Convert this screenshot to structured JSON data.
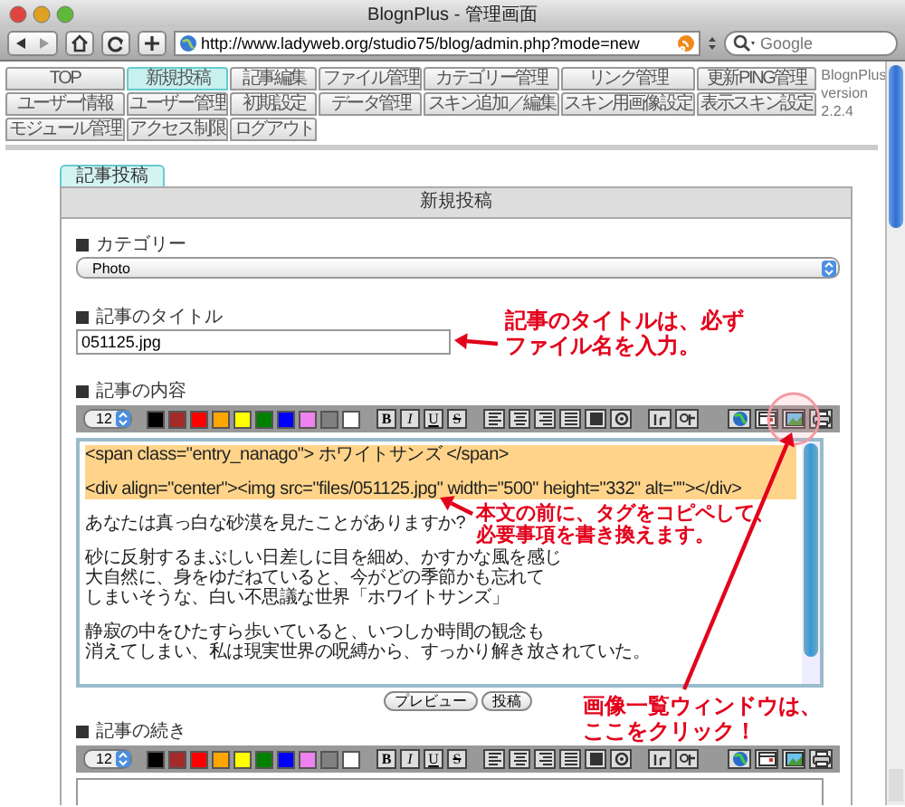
{
  "window": {
    "title": "BlognPlus - 管理画面"
  },
  "browser": {
    "url": "http://www.ladyweb.org/studio75/blog/admin.php?mode=new",
    "search": {
      "placeholder": "Google"
    }
  },
  "nav_tabs": [
    {
      "label": "TOP",
      "selected": false
    },
    {
      "label": "新規投稿",
      "selected": true
    },
    {
      "label": "記事編集",
      "selected": false
    },
    {
      "label": "ファイル管理",
      "selected": false
    },
    {
      "label": "カテゴリー管理",
      "selected": false
    },
    {
      "label": "リンク管理",
      "selected": false
    },
    {
      "label": "更新PING管理",
      "selected": false
    },
    {
      "label": "ユーザー情報",
      "selected": false
    },
    {
      "label": "ユーザー管理",
      "selected": false
    },
    {
      "label": "初期設定",
      "selected": false
    },
    {
      "label": "データ管理",
      "selected": false
    },
    {
      "label": "スキン追加／編集",
      "selected": false
    },
    {
      "label": "スキン用画像設定",
      "selected": false
    },
    {
      "label": "表示スキン設定",
      "selected": false
    },
    {
      "label": "モジュール管理",
      "selected": false
    },
    {
      "label": "アクセス制限",
      "selected": false
    },
    {
      "label": "ログアウト",
      "selected": false
    }
  ],
  "app_info": {
    "name": "BlognPlus",
    "version_label": "version",
    "version": "2.2.4"
  },
  "page_tabs": [
    {
      "label": "記事投稿",
      "selected": true
    }
  ],
  "panel": {
    "title": "新規投稿",
    "sections": [
      {
        "kind": "select",
        "heading": "カテゴリー",
        "value": "Photo"
      },
      {
        "kind": "text",
        "heading": "記事のタイトル",
        "value": "051125.jpg"
      },
      {
        "kind": "editor",
        "heading": "記事の内容",
        "font_size": "12",
        "colors": [
          {
            "color": "#000000"
          },
          {
            "color": "#a52a2a"
          },
          {
            "color": "#ff0000"
          },
          {
            "color": "#ffa500"
          },
          {
            "color": "#ffff00"
          },
          {
            "color": "#008000"
          },
          {
            "color": "#0000ff"
          },
          {
            "color": "#ee82ee"
          },
          {
            "color": "#808080"
          },
          {
            "color": "#ffffff"
          }
        ],
        "format_buttons": [
          "B",
          "I",
          "U",
          "S"
        ],
        "paragraphs": [
          {
            "highlighted": true,
            "lines": [
              "<span class=\"entry_nanago\"> ホワイトサンズ </span>"
            ]
          },
          {
            "highlighted": true,
            "lines": [
              "<div align=\"center\"><img src=\"files/051125.jpg\" width=\"500\" height=\"332\" alt=\"\"></div>"
            ]
          },
          {
            "highlighted": false,
            "lines": [
              "あなたは真っ白な砂漠を見たことがありますか?"
            ]
          },
          {
            "highlighted": false,
            "lines": [
              "砂に反射するまぶしい日差しに目を細め、かすかな風を感じ",
              "大自然に、身をゆだねていると、今がどの季節かも忘れて",
              "しまいそうな、白い不思議な世界「ホワイトサンズ」"
            ]
          },
          {
            "highlighted": false,
            "lines": [
              "静寂の中をひたすら歩いていると、いつしか時間の観念も",
              "消えてしまい、私は現実世界の呪縛から、すっかり解き放されていた。"
            ]
          }
        ],
        "buttons": [
          "プレビュー",
          "投稿"
        ]
      },
      {
        "kind": "editor",
        "heading": "記事の続き",
        "font_size": "12",
        "colors": [
          {
            "color": "#000000"
          },
          {
            "color": "#a52a2a"
          },
          {
            "color": "#ff0000"
          },
          {
            "color": "#ffa500"
          },
          {
            "color": "#ffff00"
          },
          {
            "color": "#008000"
          },
          {
            "color": "#0000ff"
          },
          {
            "color": "#ee82ee"
          },
          {
            "color": "#808080"
          },
          {
            "color": "#ffffff"
          }
        ],
        "format_buttons": [
          "B",
          "I",
          "U",
          "S"
        ]
      }
    ]
  },
  "annotations": [
    {
      "lines": [
        "記事のタイトルは、必ず",
        "ファイル名を入力。"
      ]
    },
    {
      "lines": [
        "本文の前に、タグをコピペして、",
        "必要事項を書き換えます。"
      ]
    },
    {
      "lines": [
        "画像一覧ウィンドウは、",
        "ここをクリック！"
      ]
    }
  ]
}
